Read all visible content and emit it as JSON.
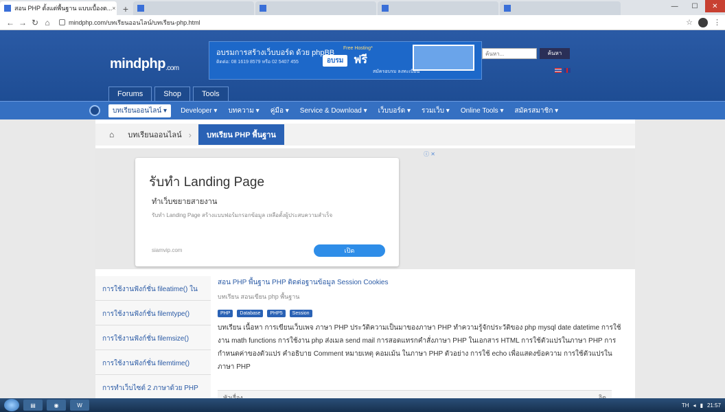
{
  "browser": {
    "tabs": [
      {
        "label": "สอน PHP ตั้งแต่พื้นฐาน แบบเบื้องต..."
      },
      {
        "label": ""
      },
      {
        "label": ""
      },
      {
        "label": ""
      },
      {
        "label": ""
      },
      {
        "label": ""
      }
    ],
    "close_symbol": "×",
    "new_tab_symbol": "+",
    "url": "mindphp.com/บทเรียนออนไลน์/บทเรียน-php.html"
  },
  "header": {
    "logo_main": "mindphp",
    "logo_sub": ".com",
    "banner": {
      "headline": "อบรมการสร้างเว็บบอร์ด ด้วย phpBB",
      "free_hosting": "Free Hosting*",
      "phone": "ติดต่อ: 08 1619 8579 หรือ 02 5407 455",
      "apply": "อบรม",
      "free": "ฟรี",
      "signup": "สมัครอบรม ลงทะเบียน"
    },
    "search_placeholder": "ค้นหา...",
    "search_button": "ค้นหา",
    "top_tabs": [
      "Forums",
      "Shop",
      "Tools"
    ]
  },
  "nav": {
    "items": [
      {
        "label": "บทเรียนออนไลน์ ▾",
        "selected": true
      },
      {
        "label": "Developer ▾"
      },
      {
        "label": "บทความ ▾"
      },
      {
        "label": "คู่มือ ▾"
      },
      {
        "label": "Service & Download ▾"
      },
      {
        "label": "เว็บบอร์ด ▾"
      },
      {
        "label": "รวมเว็บ ▾"
      },
      {
        "label": "Online Tools ▾"
      },
      {
        "label": "สมัครสมาชิก ▾"
      }
    ]
  },
  "breadcrumb": {
    "home_icon": "home-icon",
    "items": [
      "บทเรียนออนไลน์",
      "บทเรียน PHP พื้นฐาน"
    ]
  },
  "ad": {
    "choice": "ⓘ ✕",
    "title": "รับทำ Landing Page",
    "subtitle": "ทำเว็บขยายสายงาน",
    "description": "รับทำ Landing Page สร้างแบบฟอร์มกรอกข้อมูล เหลือตั้งผู้ประสบความสำเร็จ",
    "domain": "siamvip.com",
    "button": "เปิด"
  },
  "sidebar": {
    "items": [
      "การใช้งานฟังก์ชั่น fileatime() ใน",
      "การใช้งานฟังก์ชั่น filemtype()",
      "การใช้งานฟังก์ชั่น filemsize()",
      "การใช้งานฟังก์ชั่น filemtime()",
      "การทำเว็บไซต์ 2 ภาษาด้วย PHP"
    ]
  },
  "article": {
    "title": "สอน PHP พื้นฐาน PHP ติดต่อฐานข้อมูล Session Cookies",
    "crumb": "บทเรียน สอนเขียน php พื้นฐาน",
    "tags": [
      "PHP",
      "Database",
      "PHP5",
      "Session"
    ],
    "body": "บทเรียน เนื้อหา การเขียนเว็บเพจ ภาษา PHP ประวัติความเป็นมาของภาษา PHP ทำความรู้จักประวัติของ php mysql date datetime การใช้งาน math functions การใช้งาน php ส่งเมล send mail การสอดแทรกคำสั่งภาษา PHP ในเอกสาร HTML การใช้ตัวแปรในภาษา PHP การกำหนดค่าของตัวแปร คำอธิบาย Comment หมายเหตุ คอมเม้น ในภาษา PHP ตัวอย่าง การใช้ echo เพื่อแสดงข้อความ การใช้ตัวแปรในภาษา PHP",
    "toc_left": "หัวเรื่อง",
    "toc_right": "อิด"
  },
  "taskbar": {
    "lang": "TH",
    "time": "21:57"
  }
}
